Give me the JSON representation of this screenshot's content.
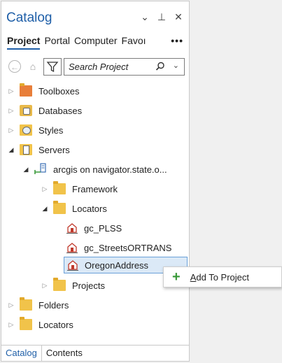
{
  "pane": {
    "title": "Catalog",
    "controls": {
      "dropdown": "⌄",
      "pin": "⊥",
      "close": "✕"
    },
    "tabs": [
      "Project",
      "Portal",
      "Computer",
      "Favoı"
    ],
    "overflow": "•••"
  },
  "toolbar": {
    "search_placeholder": "Search Project"
  },
  "tree": {
    "toolboxes": "Toolboxes",
    "databases": "Databases",
    "styles": "Styles",
    "servers": "Servers",
    "server_connection": "arcgis on navigator.state.o...",
    "framework": "Framework",
    "locators_server": "Locators",
    "locator_1": "gc_PLSS",
    "locator_2": "gc_StreetsORTRANS",
    "locator_3": "OregonAddress",
    "projects": "Projects",
    "folders": "Folders",
    "locators": "Locators"
  },
  "context_menu": {
    "first_letter": "A",
    "rest": "dd To Project"
  },
  "bottom_tabs": [
    "Catalog",
    "Contents"
  ],
  "colors": {
    "accent": "#1f5fa8",
    "selection": "#dbe9f7",
    "folder": "#f1c34a",
    "add": "#3a9a3a"
  }
}
